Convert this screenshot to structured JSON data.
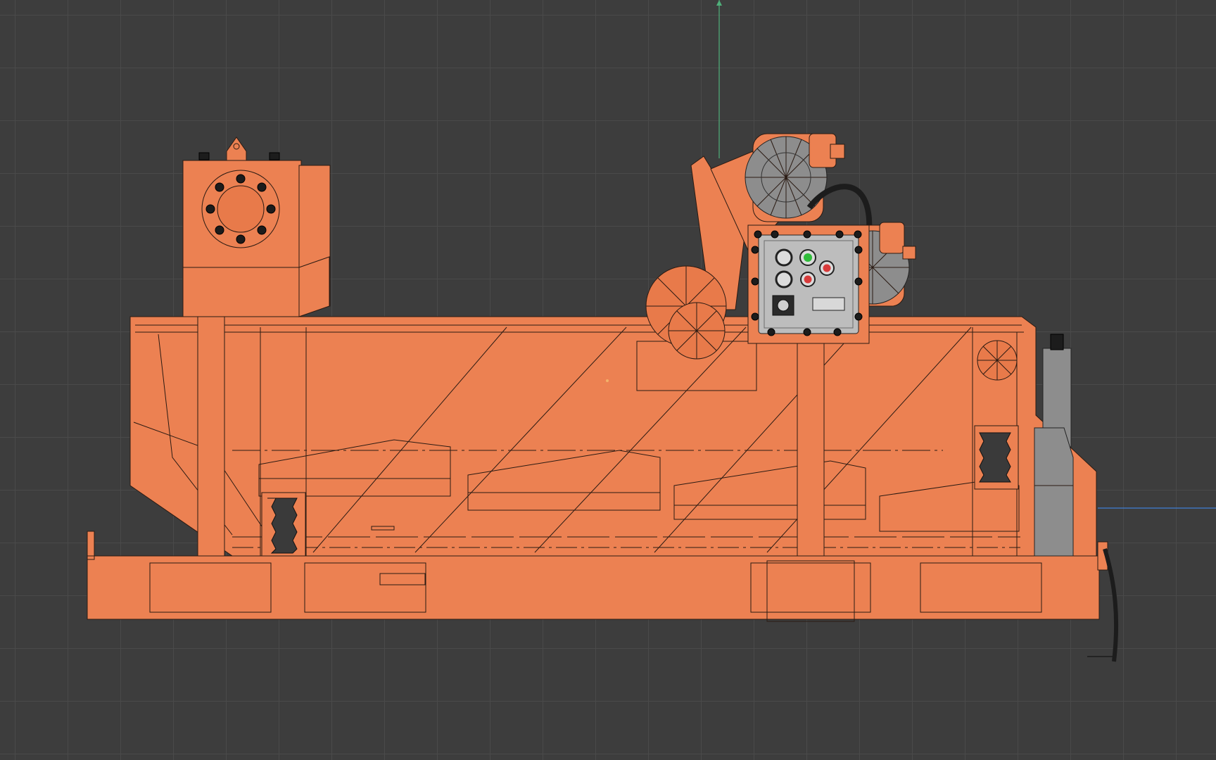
{
  "viewport": {
    "background_color": "#3d3d3d",
    "grid_color": "#4a4a4a",
    "axis_y_color": "#4fb07a",
    "axis_x_color": "#3f7fd6"
  },
  "model": {
    "body_color": "#ec8152",
    "edge_color": "#2a1a12",
    "motor_color": "#8d8d8d"
  },
  "control_box": {
    "indicator_colors": [
      "#3a3a3a",
      "#2fbd3a",
      "#d83a3a",
      "#3a3a3a",
      "#d83a3a"
    ]
  }
}
